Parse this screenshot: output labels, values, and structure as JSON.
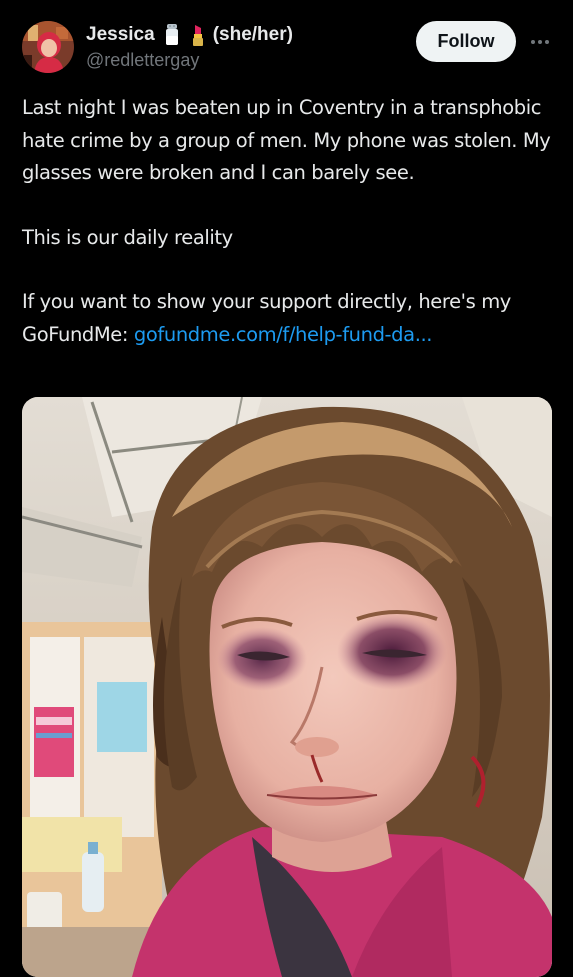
{
  "author": {
    "display_name": "Jessica",
    "emojis": [
      "salt-shaker-emoji",
      "lipstick-emoji"
    ],
    "pronouns": "(she/her)",
    "handle": "@redlettergay"
  },
  "actions": {
    "follow_label": "Follow",
    "more_icon": "ellipsis-icon"
  },
  "tweet": {
    "paragraph_1": "Last night I was beaten up in Coventry in a transphobic hate crime by a group of men. My phone was stolen. My glasses were broken and I can barely see.",
    "paragraph_2": "This is our daily reality",
    "paragraph_3_prefix": "If you want to show your support directly, here's my GoFundMe: ",
    "link_text": "gofundme.com/f/help-fund-da..."
  },
  "colors": {
    "background": "#000000",
    "text": "#e7e9ea",
    "secondary_text": "#71767b",
    "link": "#1d9bf0",
    "follow_button_bg": "#eff3f4"
  }
}
